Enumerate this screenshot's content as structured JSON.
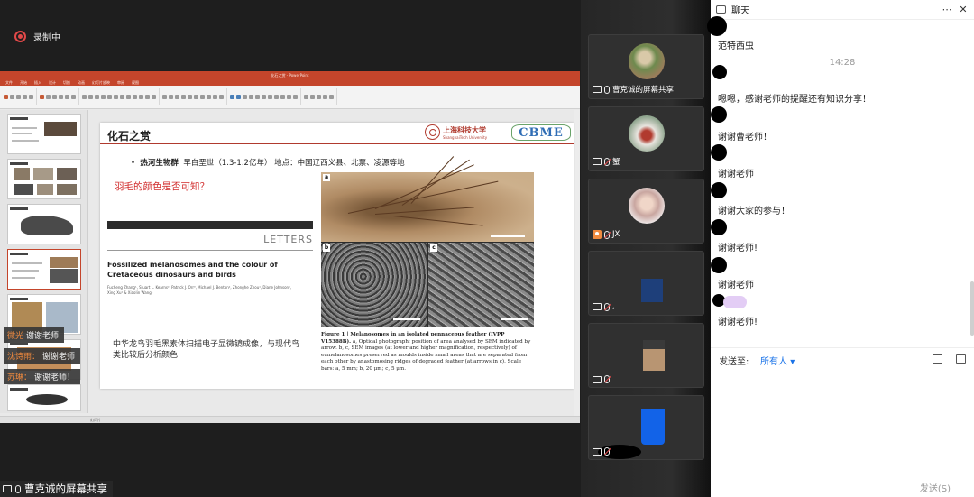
{
  "recording": {
    "label": "录制中"
  },
  "ppt": {
    "window_title": "化石之赏 - PowerPoint",
    "tabs": [
      "文件",
      "开始",
      "插入",
      "设计",
      "切换",
      "动画",
      "幻灯片放映",
      "审阅",
      "视图"
    ],
    "status": "幻灯片"
  },
  "thumb_overlays": [
    {
      "name": "微光",
      "text": "谢谢老师"
    },
    {
      "name": "沈诗雨：",
      "text": "谢谢老师"
    },
    {
      "name": "苏琳：",
      "text": "谢谢老师！"
    }
  ],
  "slide": {
    "title": "化石之赏",
    "uni_cn": "上海科技大学",
    "uni_en": "ShanghaiTech University",
    "lab_logo": "CBME",
    "bullet_bold": "热河生物群",
    "bullet_rest": "早白垩世（1.3-1.2亿年） 地点：中国辽西义县、北票、凌源等地",
    "question": "羽毛的颜色是否可知？",
    "article": {
      "section": "LETTERS",
      "title": "Fossilized melanosomes and the colour of Cretaceous dinosaurs and birds",
      "authors": "Fucheng Zhang¹, Stuart L. Kearns², Patrick J. Orr³, Michael J. Benton², Zhonghe Zhou¹, Diane Johnson⁴, Xing Xu¹ & Xiaolin Wang¹"
    },
    "cn_caption": "中华龙鸟羽毛黑素体扫描电子显微镜成像，与现代鸟类比较后分析颜色",
    "figure": {
      "labels": [
        "a",
        "b",
        "c"
      ],
      "caption_bold": "Figure 1 | Melanosomes in an isolated pennaceous feather (IVPP V15388B).",
      "caption_rest": " a, Optical photograph; position of area analysed by SEM indicated by arrow. b, c, SEM images (at lower and higher magnification, respectively) of eumelanosomes preserved as moulds inside small areas that are separated from each other by anastomosing ridges of degraded feather (at arrows in c). Scale bars: a, 5 mm; b, 20 μm; c, 5 μm."
    }
  },
  "sharer": {
    "label": "曹克诚的屏幕共享"
  },
  "participants": [
    {
      "name": "曹克诚的屏幕共享"
    },
    {
      "name": "蟹"
    },
    {
      "name": "JX"
    },
    {
      "name": ","
    },
    {
      "name": ""
    },
    {
      "name": ""
    }
  ],
  "chat": {
    "title": "聊天",
    "messages": [
      {
        "text": "范特西虫"
      },
      {
        "text": "嗯嗯，感谢老师的提醒还有知识分享！"
      },
      {
        "text": "谢谢曹老师！"
      },
      {
        "text": "谢谢老师"
      },
      {
        "text": "谢谢大家的参与！"
      },
      {
        "text": "谢谢老师!"
      },
      {
        "text": "谢谢老师"
      },
      {
        "text": "谢谢老师!"
      }
    ],
    "timestamp": "14:28",
    "send_to_label": "发送至:",
    "send_to_value": "所有人",
    "send_button": "发送(S)"
  }
}
